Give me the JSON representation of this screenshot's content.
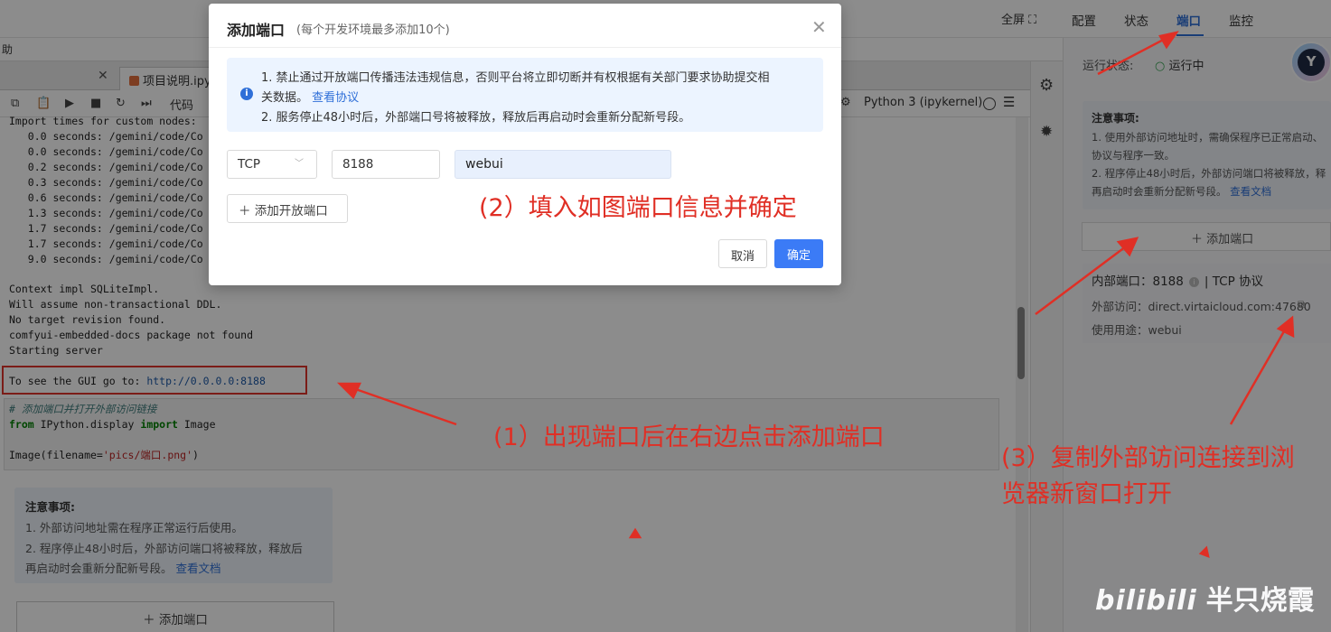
{
  "topbar": {
    "fullscreen_label": "全屏 ⛶"
  },
  "menubar": {
    "help_label": "助"
  },
  "tabs": {
    "close_symbol": "✕",
    "active_tab": "项目说明.ipy"
  },
  "toolbar": {
    "code_label": "代码",
    "kernel_label": "Python 3 (ipykernel)"
  },
  "output": {
    "lines1": [
      "Import times for custom nodes:",
      "   0.0 seconds: /gemini/code/Co",
      "   0.0 seconds: /gemini/code/Co",
      "   0.2 seconds: /gemini/code/Co",
      "   0.3 seconds: /gemini/code/Co",
      "   0.6 seconds: /gemini/code/Co",
      "   1.3 seconds: /gemini/code/Co",
      "   1.7 seconds: /gemini/code/Co",
      "   1.7 seconds: /gemini/code/Co",
      "   9.0 seconds: /gemini/code/Co"
    ],
    "lines2": [
      "Context impl SQLiteImpl.",
      "Will assume non-transactional DDL.",
      "No target revision found.",
      "comfyui-embedded-docs package not found",
      "Starting server"
    ],
    "gui_prefix": "To see the GUI go to: ",
    "gui_url": "http://0.0.0.0:8188"
  },
  "code_cell": {
    "comment": "# 添加端口并打开外部访问链接",
    "from_kw": "from",
    "module": " IPython.display ",
    "import_kw": "import",
    "name": " Image",
    "call_prefix": "Image(filename=",
    "call_str": "'pics/端口.png'",
    "call_suffix": ")"
  },
  "left_note": {
    "title": "注意事项:",
    "line1": "1. 外部访问地址需在程序正常运行后使用。",
    "line2": "2. 程序停止48小时后，外部访问端口将被释放，释放后",
    "line3": "再启动时会重新分配新号段。",
    "link": "查看文档",
    "add_port": "添加端口"
  },
  "right_panel": {
    "tabs": [
      "配置",
      "状态",
      "端口",
      "监控"
    ],
    "active_tab_index": 2,
    "run_status_label": "运行状态:",
    "run_status_value": "运行中",
    "note_title": "注意事项:",
    "note_line1": "1. 使用外部访问地址时，需确保程序已正常启动、",
    "note_line2": "协议与程序一致。",
    "note_line3": "2. 程序停止48小时后，外部访问端口将被释放，释",
    "note_line4": "再启动时会重新分配新号段。",
    "note_link": "查看文档",
    "add_port": "添加端口",
    "internal_port_label": "内部端口：8188",
    "protocol": "TCP 协议",
    "external_access": "外部访问：direct.virtaicloud.com:47680",
    "usage": "使用用途：webui",
    "avatar_letter": "Y"
  },
  "modal": {
    "title": "添加端口",
    "subtitle": "(每个开发环境最多添加10个)",
    "alert_line1": "1. 禁止通过开放端口传播违法违规信息，否则平台将立即切断并有权根据有关部门要求协助提交相",
    "alert_line2_prefix": "关数据。",
    "alert_link": "查看协议",
    "alert_line3": "2. 服务停止48小时后，外部端口号将被释放，释放后再启动时会重新分配新号段。",
    "protocol_value": "TCP",
    "port_value": "8188",
    "name_value": "webui",
    "add_open_port": "添加开放端口",
    "cancel": "取消",
    "confirm": "确定"
  },
  "annotations": {
    "step1": "(1）出现端口后在右边点击添加端口",
    "step2": "(2）填入如图端口信息并确定",
    "step3_line1": "(3）复制外部访问连接到浏",
    "step3_line2": "览器新窗口打开"
  },
  "watermark": {
    "logo": "bilibili",
    "author": "半只烧霞"
  },
  "colors": {
    "accent": "#2f6fd8",
    "annotation": "#e02f25",
    "confirm_button": "#3b7bf6"
  }
}
